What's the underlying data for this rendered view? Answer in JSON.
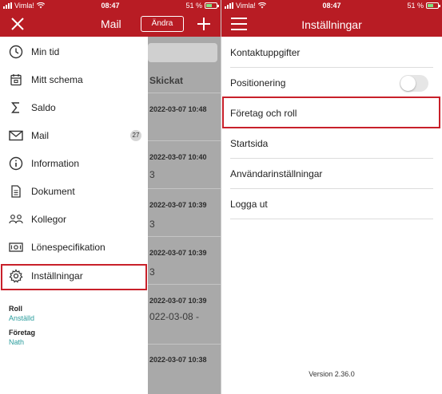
{
  "status_bar_left": {
    "carrier": "Vimla!",
    "time": "08:47",
    "battery": "51 %"
  },
  "status_bar_right": {
    "carrier": "Vimla!",
    "time": "08:47",
    "battery": "51 %"
  },
  "mail_screen": {
    "title": "Mail",
    "edit_button": "Ändra",
    "column_header": "Skickat",
    "rows": [
      {
        "date": "2022-03-07 10:48",
        "sub": ""
      },
      {
        "date": "2022-03-07 10:40",
        "sub": "3"
      },
      {
        "date": "2022-03-07 10:39",
        "sub": "3"
      },
      {
        "date": "2022-03-07 10:39",
        "sub": "3"
      },
      {
        "date": "2022-03-07 10:39",
        "sub": "022-03-08 -"
      },
      {
        "date": "2022-03-07 10:38",
        "sub": ""
      }
    ]
  },
  "drawer": {
    "items": [
      {
        "label": "Min tid",
        "icon": "clock-icon"
      },
      {
        "label": "Mitt schema",
        "icon": "calendar-icon"
      },
      {
        "label": "Saldo",
        "icon": "sigma-icon"
      },
      {
        "label": "Mail",
        "icon": "mail-icon",
        "badge": "27"
      },
      {
        "label": "Information",
        "icon": "info-icon"
      },
      {
        "label": "Dokument",
        "icon": "document-icon"
      },
      {
        "label": "Kollegor",
        "icon": "people-icon"
      },
      {
        "label": "Lönespecifikation",
        "icon": "payslip-icon"
      },
      {
        "label": "Inställningar",
        "icon": "gear-icon",
        "highlighted": true
      }
    ],
    "role_label": "Roll",
    "role_value": "Anställd",
    "company_label": "Företag",
    "company_value": "Nath"
  },
  "settings_screen": {
    "title": "Inställningar",
    "items": [
      {
        "label": "Kontaktuppgifter"
      },
      {
        "label": "Positionering",
        "toggle": false
      },
      {
        "label": "Företag och roll",
        "highlighted": true
      },
      {
        "label": "Startsida"
      },
      {
        "label": "Användarinställningar"
      },
      {
        "label": "Logga ut"
      }
    ],
    "version": "Version 2.36.0"
  },
  "colors": {
    "brand_red": "#b81c24",
    "highlight_red": "#c8202a",
    "teal_text": "#2a9d9d"
  }
}
